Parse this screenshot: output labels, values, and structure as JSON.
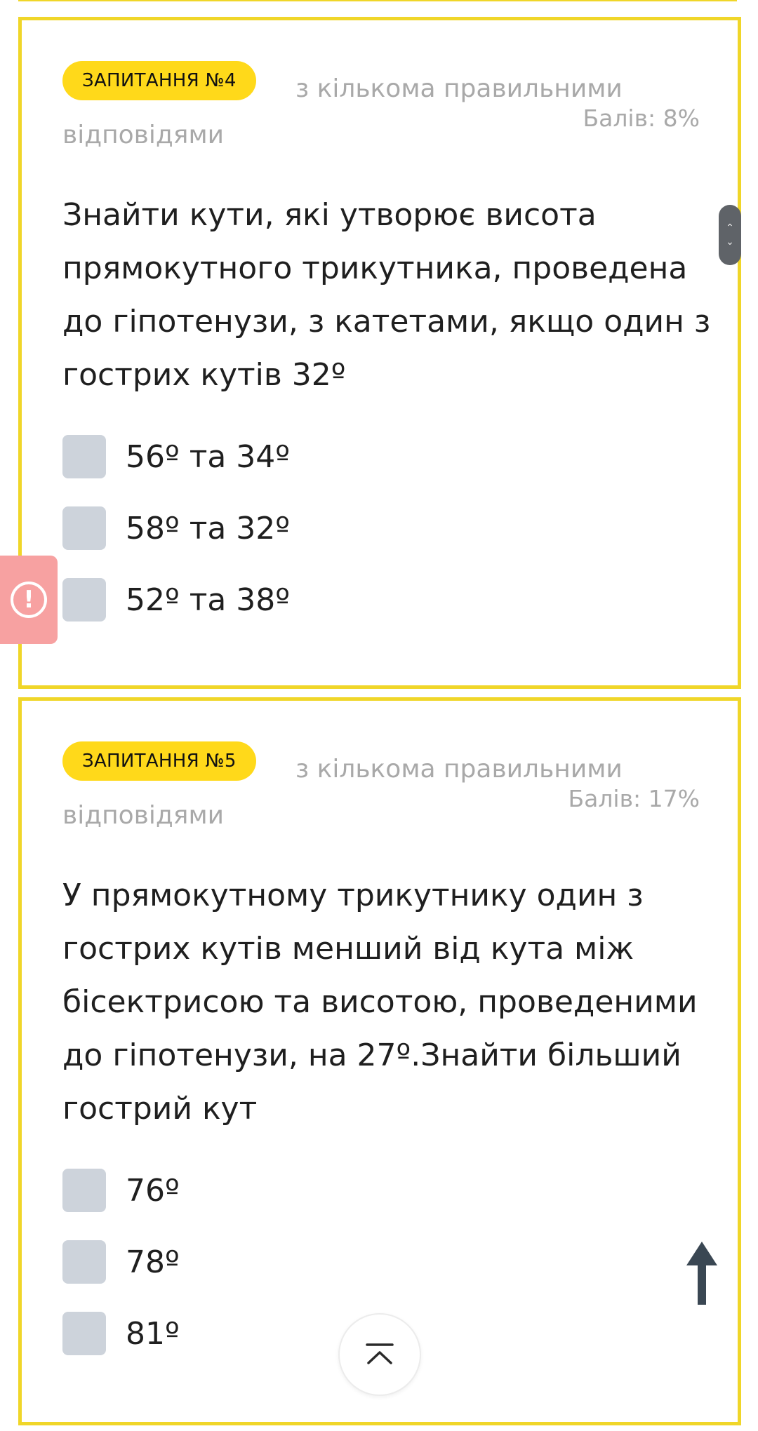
{
  "questions": [
    {
      "badge": "ЗАПИТАННЯ №4",
      "type": "з кількома правильними відповідями",
      "score": "Балів: 8%",
      "text": "Знайти кути, які утворює висота прямокутного трикутника, проведена до гіпотенузи, з катетами, якщо один з гострих кутів 32º",
      "options": [
        "56º та 34º",
        "58º та 32º",
        "52º та 38º"
      ]
    },
    {
      "badge": "ЗАПИТАННЯ №5",
      "type": "з кількома правильними відповідями",
      "score": "Балів: 17%",
      "text": "У прямокутному трикутнику один з гострих кутів менший від кута між бісектрисою та висотою, проведеними до гіпотенузи, на 27º.Знайти більший гострий кут",
      "options": [
        "76º",
        "78º",
        "81º"
      ]
    }
  ],
  "report_tab": {
    "icon": "exclamation-circle-icon",
    "glyph": "!"
  },
  "scroll_handle": {
    "icon": "chevron-up-down-icon",
    "up_glyph": "⌃",
    "down_glyph": "⌄"
  },
  "colors": {
    "card_border": "#f0d629",
    "badge_bg": "#ffd91a",
    "muted_text": "#a9a9a9",
    "checkbox": "#cdd3db",
    "report_tab": "#f7a1a1",
    "arrow": "#3a4753"
  }
}
